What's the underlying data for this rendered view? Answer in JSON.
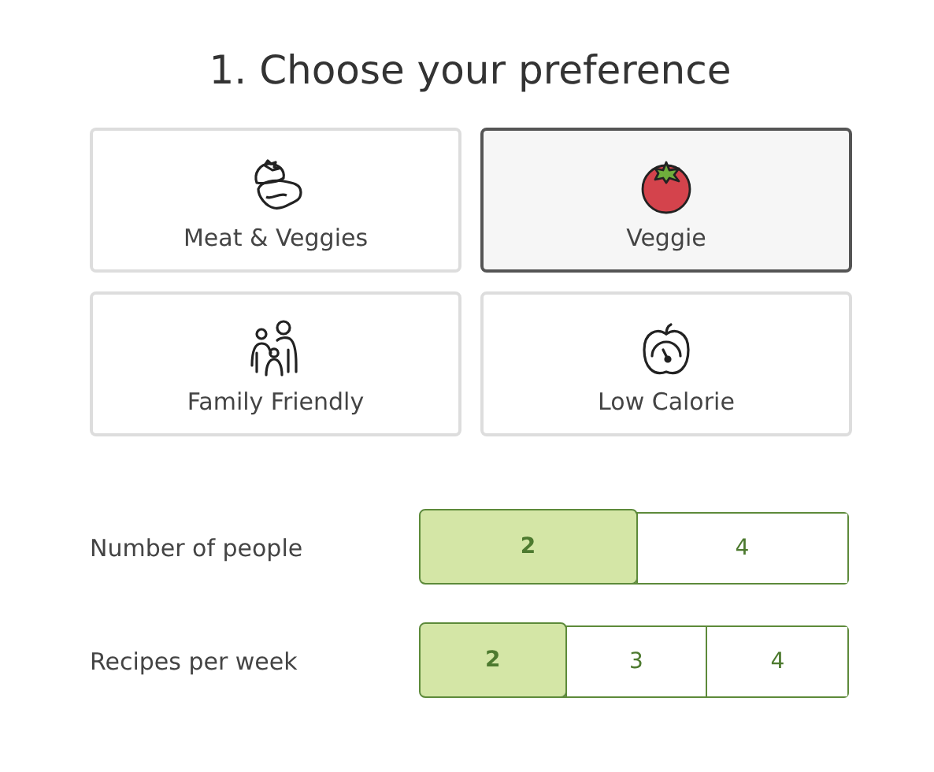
{
  "title": "1. Choose your preference",
  "preferences": [
    {
      "label": "Meat & Veggies",
      "kind": "meat",
      "selected": false
    },
    {
      "label": "Veggie",
      "kind": "tomato",
      "selected": true
    },
    {
      "label": "Family Friendly",
      "kind": "family",
      "selected": false
    },
    {
      "label": "Low Calorie",
      "kind": "calorie",
      "selected": false
    }
  ],
  "options": [
    {
      "label": "Number of people",
      "choices": [
        {
          "label": "2",
          "selected": true
        },
        {
          "label": "4",
          "selected": false
        }
      ]
    },
    {
      "label": "Recipes per week",
      "choices": [
        {
          "label": "2",
          "selected": true
        },
        {
          "label": "3",
          "selected": false
        },
        {
          "label": "4",
          "selected": false
        }
      ]
    }
  ]
}
